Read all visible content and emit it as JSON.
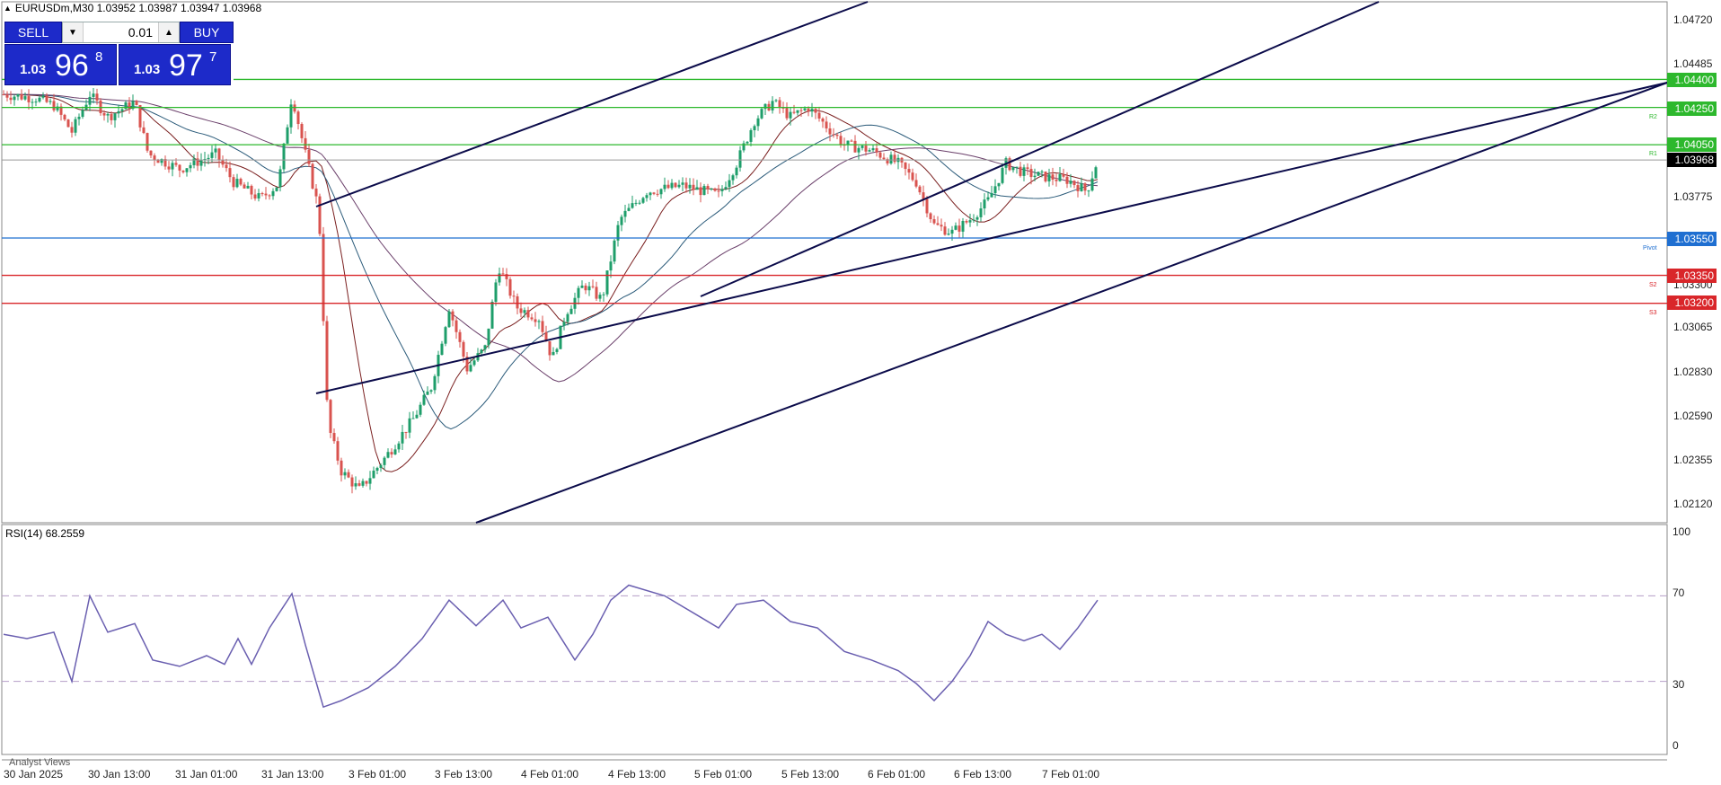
{
  "header": {
    "symbol_info": "EURUSDm,M30  1.03952 1.03987 1.03947 1.03968"
  },
  "trade_panel": {
    "sell_label": "SELL",
    "buy_label": "BUY",
    "lot_value": "0.01",
    "sell_quote": {
      "prefix": "1.03",
      "big": "96",
      "sup": "8"
    },
    "buy_quote": {
      "prefix": "1.03",
      "big": "97",
      "sup": "7"
    }
  },
  "price_axis": {
    "labels": [
      "1.04720",
      "1.04485",
      "1.03775",
      "1.03300",
      "1.03065",
      "1.02830",
      "1.02590",
      "1.02355",
      "1.02120"
    ]
  },
  "levels": [
    {
      "price": "1.04400",
      "label": "",
      "color": "#2db82d"
    },
    {
      "price": "1.04250",
      "label": "R2",
      "color": "#2db82d"
    },
    {
      "price": "1.04050",
      "label": "R1",
      "color": "#2db82d"
    },
    {
      "price": "1.03550",
      "label": "Pivot",
      "color": "#1f6fd1"
    },
    {
      "price": "1.03350",
      "label": "S2",
      "color": "#d9262a"
    },
    {
      "price": "1.03200",
      "label": "S3",
      "color": "#d9262a"
    }
  ],
  "current_price": {
    "price": "1.03968",
    "color": "#000000"
  },
  "time_axis": {
    "labels": [
      "30 Jan 2025",
      "30 Jan 13:00",
      "31 Jan 01:00",
      "31 Jan 13:00",
      "3 Feb 01:00",
      "3 Feb 13:00",
      "4 Feb 01:00",
      "4 Feb 13:00",
      "5 Feb 01:00",
      "5 Feb 13:00",
      "6 Feb 01:00",
      "6 Feb 13:00",
      "7 Feb 01:00"
    ]
  },
  "rsi": {
    "title": "RSI(14) 68.2559",
    "levels": [
      "100",
      "70",
      "30",
      "0"
    ]
  },
  "footer": {
    "analyst_views": "Analyst Views"
  },
  "colors": {
    "bull": "#1e9e6a",
    "bear": "#d9534f",
    "channel": "#0b0b4a",
    "rsi_line": "#6a5fb0"
  }
}
